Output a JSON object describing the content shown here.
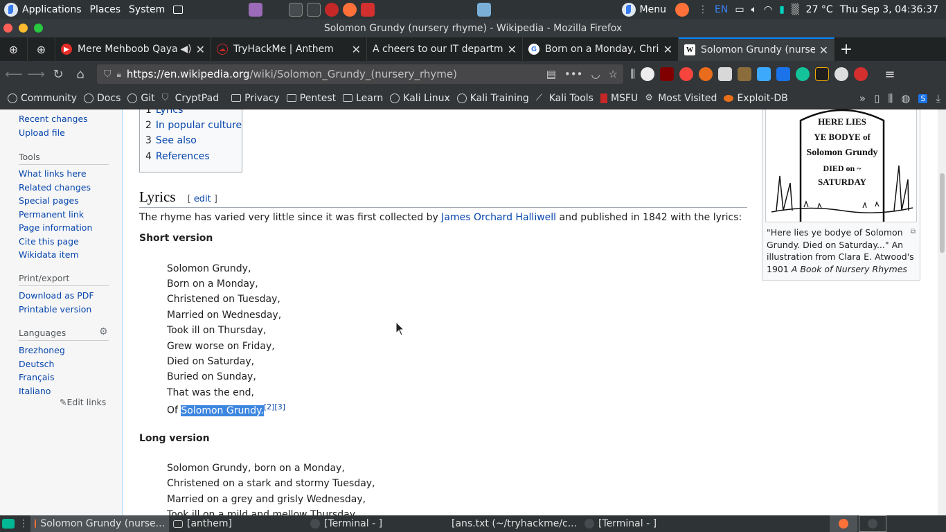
{
  "top_panel": {
    "applications": "Applications",
    "places": "Places",
    "system": "System",
    "menu": "Menu",
    "lang": "EN",
    "temperature": "27 °C",
    "datetime": "Thu Sep 3, 04:36:37"
  },
  "window": {
    "title": "Solomon Grundy (nursery rhyme) - Wikipedia - Mozilla Firefox"
  },
  "tabs": [
    {
      "label": "Mere Mehboob Qayamat Hogi",
      "favicon_color": "#e52d27"
    },
    {
      "label": "TryHackMe | Anthem",
      "favicon_color": "#c62828"
    },
    {
      "label": "A cheers to our IT department",
      "favicon_color": "#202324"
    },
    {
      "label": "Born on a Monday, Christened",
      "favicon_color": "#4285f4"
    },
    {
      "label": "Solomon Grundy (nursery rhyme)",
      "favicon_color": "#ffffff"
    }
  ],
  "nav": {
    "url_domain": "https://en.wikipedia.org",
    "url_path": "/wiki/Solomon_Grundy_(nursery_rhyme)"
  },
  "bookmarks": [
    {
      "label": "Community",
      "icon": "globe"
    },
    {
      "label": "Docs",
      "icon": "globe"
    },
    {
      "label": "Git",
      "icon": "globe"
    },
    {
      "label": "CryptPad",
      "icon": "shield"
    },
    {
      "label": "Privacy",
      "icon": "folder"
    },
    {
      "label": "Pentest",
      "icon": "folder"
    },
    {
      "label": "Learn",
      "icon": "folder"
    },
    {
      "label": "Kali Linux",
      "icon": "globe"
    },
    {
      "label": "Kali Training",
      "icon": "globe"
    },
    {
      "label": "Kali Tools",
      "icon": "kali"
    },
    {
      "label": "MSFU",
      "icon": "msf"
    },
    {
      "label": "Most Visited",
      "icon": "gear"
    },
    {
      "label": "Exploit-DB",
      "icon": "exploit"
    }
  ],
  "sidebar": {
    "links_top": [
      "Recent changes",
      "Upload file"
    ],
    "tools_heading": "Tools",
    "tools": [
      "What links here",
      "Related changes",
      "Special pages",
      "Permanent link",
      "Page information",
      "Cite this page",
      "Wikidata item"
    ],
    "print_heading": "Print/export",
    "print": [
      "Download as PDF",
      "Printable version"
    ],
    "languages_heading": "Languages",
    "languages": [
      "Brezhoneg",
      "Deutsch",
      "Français",
      "Italiano"
    ],
    "edit_links": "Edit links"
  },
  "toc": [
    {
      "num": "1",
      "title": "Lyrics"
    },
    {
      "num": "2",
      "title": "In popular culture"
    },
    {
      "num": "3",
      "title": "See also"
    },
    {
      "num": "4",
      "title": "References"
    }
  ],
  "article": {
    "section_title": "Lyrics",
    "edit_label": "edit",
    "intro_before": "The rhyme has varied very little since it was first collected by ",
    "intro_link": "James Orchard Halliwell",
    "intro_after": " and published in 1842 with the lyrics:",
    "short_heading": "Short version",
    "short_lines": [
      "Solomon Grundy,",
      "Born on a Monday,",
      "Christened on Tuesday,",
      "Married on Wednesday,",
      "Took ill on Thursday,",
      "Grew worse on Friday,",
      "Died on Saturday,",
      "Buried on Sunday,",
      "That was the end,"
    ],
    "last_prefix": "Of ",
    "last_selected": "Solomon Grundy.",
    "last_refs": "[2][3]",
    "long_heading": "Long version",
    "long_lines": [
      "Solomon Grundy, born on a Monday,",
      "Christened on a stark and stormy Tuesday,",
      "Married on a grey and grisly Wednesday,",
      "Took ill on a mild and mellow Thursday,"
    ]
  },
  "thumb": {
    "image_lines": [
      "HERE LIES",
      "YE BODYE of",
      "Solomon Grundy",
      "DIED on ~",
      "SATURDAY"
    ],
    "caption_main": "\"Here lies ye bodye of Solomon Grundy. Died on Saturday...\" An illustration from Clara E. Atwood's 1901 ",
    "caption_italic": "A Book of Nursery Rhymes"
  },
  "taskbar": [
    {
      "label": "Solomon Grundy (nurse...",
      "icon": "firefox"
    },
    {
      "label": "[anthem]",
      "icon": "folder"
    },
    {
      "label": "[Terminal - ]",
      "icon": "terminal"
    },
    {
      "label": "[ans.txt (~/tryhackme/c...",
      "icon": "editor"
    },
    {
      "label": "[Terminal - ]",
      "icon": "terminal"
    }
  ]
}
